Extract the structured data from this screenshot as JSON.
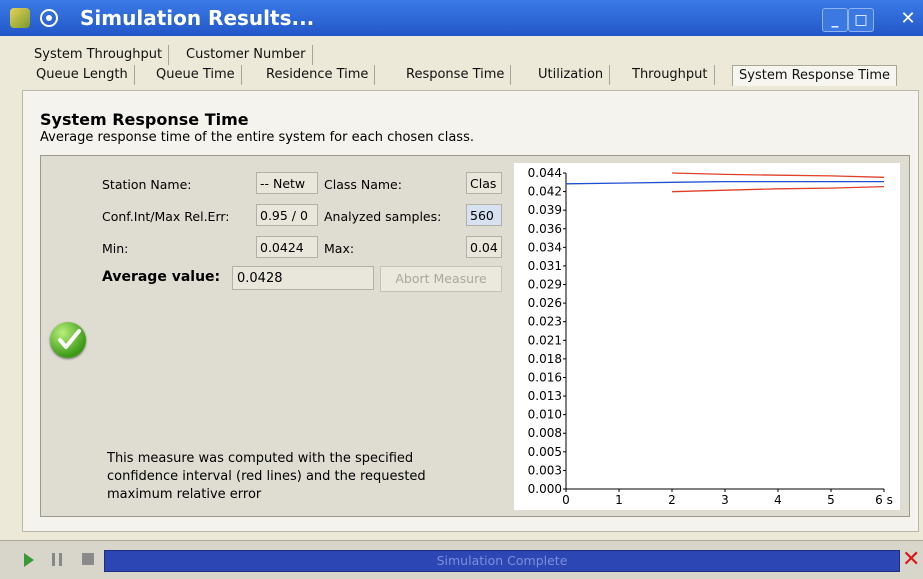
{
  "window": {
    "title": "Simulation Results...",
    "minimize_label": "_",
    "maximize_label": "□",
    "close_label": "✕"
  },
  "tabs": {
    "row1": [
      "System Throughput",
      "Customer Number"
    ],
    "row2": [
      "Queue Length",
      "Queue Time",
      "Residence Time",
      "Response Time",
      "Utilization",
      "Throughput",
      "System Response Time"
    ],
    "active": "System Response Time"
  },
  "section": {
    "title": "System Response Time",
    "description": "Average response time of the entire system for each chosen class."
  },
  "measure": {
    "station_name_label": "Station Name:",
    "station_name_value": "-- Netw",
    "class_name_label": "Class Name:",
    "class_name_value": "Clas",
    "conf_label": "Conf.Int/Max Rel.Err:",
    "conf_value": "0.95 / 0",
    "samples_label": "Analyzed samples:",
    "samples_value": "560",
    "min_label": "Min:",
    "min_value": "0.0424",
    "max_label": "Max:",
    "max_value": "0.04",
    "average_label": "Average value:",
    "average_value": "0.0428",
    "abort_button": "Abort Measure",
    "note": "This measure was computed with the specified confidence interval (red lines) and the requested maximum relative error",
    "status_icon": "check-icon"
  },
  "chart_data": {
    "type": "line",
    "y_tick_labels": [
      "0.044",
      "0.042",
      "0.039",
      "0.036",
      "0.034",
      "0.031",
      "0.029",
      "0.026",
      "0.023",
      "0.021",
      "0.018",
      "0.016",
      "0.013",
      "0.010",
      "0.008",
      "0.005",
      "0.003",
      "0.000"
    ],
    "x_tick_labels": [
      "0",
      "1",
      "2",
      "3",
      "4",
      "5",
      "6 s"
    ],
    "xlim": [
      0,
      6
    ],
    "ylim": [
      0,
      0.044
    ],
    "series": [
      {
        "color": "#1f4fd1",
        "x": [
          0,
          1,
          2,
          3,
          4,
          5,
          6
        ],
        "y": [
          0.0425,
          0.0426,
          0.0427,
          0.0428,
          0.0428,
          0.0428,
          0.0428
        ]
      },
      {
        "color": "#e0402a",
        "x": [
          2,
          3,
          4,
          5,
          6
        ],
        "y": [
          0.044,
          0.0438,
          0.0437,
          0.0436,
          0.0434
        ]
      },
      {
        "color": "#e0402a",
        "x": [
          2,
          3,
          4,
          5,
          6
        ],
        "y": [
          0.0414,
          0.0416,
          0.0418,
          0.0419,
          0.0421
        ]
      }
    ],
    "grid": false
  },
  "status_bar": {
    "progress_text": "Simulation Complete",
    "progress": 1.0
  }
}
